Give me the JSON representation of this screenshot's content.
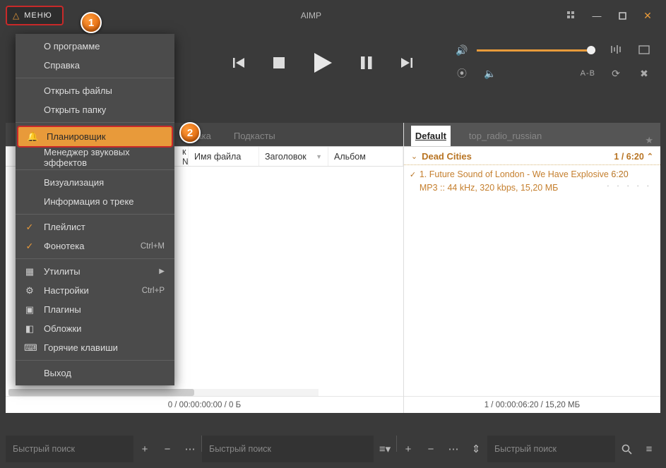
{
  "title": "AIMP",
  "menu_button": "МЕНЮ",
  "annotations": {
    "b1": "1",
    "b2": "2"
  },
  "dropdown": {
    "about": "О программе",
    "help": "Справка",
    "open_files": "Открыть файлы",
    "open_folder": "Открыть папку",
    "scheduler": "Планировщик",
    "fx_manager": "Менеджер звуковых эффектов",
    "visualization": "Визуализация",
    "track_info": "Информация о треке",
    "playlist": "Плейлист",
    "library": "Фонотека",
    "library_shortcut": "Ctrl+M",
    "utilities": "Утилиты",
    "settings": "Настройки",
    "settings_shortcut": "Ctrl+P",
    "plugins": "Плагины",
    "skins": "Обложки",
    "hotkeys": "Горячие клавиши",
    "exit": "Выход"
  },
  "right_controls": {
    "ab": "A-B"
  },
  "left_tabs": {
    "clouds_partial": "блака",
    "podcasts": "Подкасты"
  },
  "right_tabs": {
    "default": "Default",
    "top_radio": "top_radio_russian"
  },
  "columns": {
    "num": "к №",
    "filename": "Имя файла",
    "title_col": "Заголовок",
    "album": "Альбом"
  },
  "playlist": {
    "group_title": "Dead Cities",
    "group_pos": "1 / 6:20",
    "track_line1": "1. Future Sound of London - We Have Explosive",
    "track_dur": "6:20",
    "track_line2": "MP3 :: 44 kHz, 320 kbps, 15,20 МБ"
  },
  "status": {
    "left": "0 / 00:00:00:00 / 0 Б",
    "right": "1 / 00:00:06:20 / 15,20 МБ"
  },
  "search": {
    "placeholder": "Быстрый поиск"
  }
}
